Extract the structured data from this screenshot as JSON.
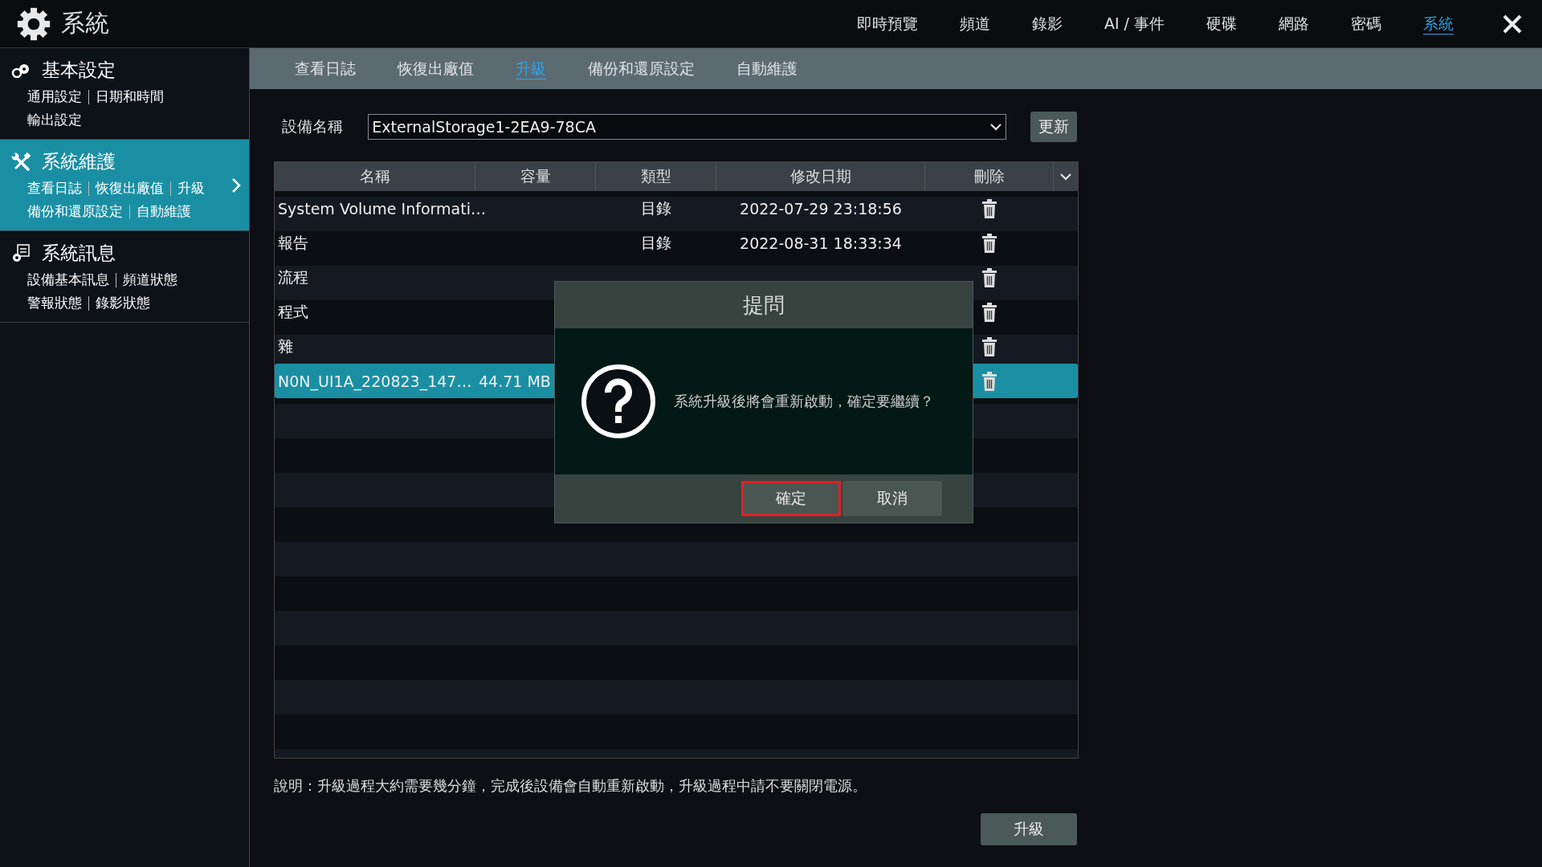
{
  "header": {
    "title": "系統",
    "nav": [
      {
        "label": "即時預覽",
        "selected": false
      },
      {
        "label": "頻道",
        "selected": false
      },
      {
        "label": "錄影",
        "selected": false
      },
      {
        "label": "AI / 事件",
        "selected": false
      },
      {
        "label": "硬碟",
        "selected": false
      },
      {
        "label": "網路",
        "selected": false
      },
      {
        "label": "密碼",
        "selected": false
      },
      {
        "label": "系統",
        "selected": true
      }
    ]
  },
  "sidebar": [
    {
      "kind": "gears",
      "title": "基本設定",
      "selected": false,
      "links": [
        [
          "通用設定",
          "日期和時間"
        ],
        [
          "輸出設定"
        ]
      ]
    },
    {
      "kind": "tools",
      "title": "系統維護",
      "selected": true,
      "links": [
        [
          "查看日誌",
          "恢復出廠值",
          "升級"
        ],
        [
          "備份和還原設定",
          "自動維護"
        ]
      ]
    },
    {
      "kind": "info",
      "title": "系統訊息",
      "selected": false,
      "links": [
        [
          "設備基本訊息",
          "頻道狀態"
        ],
        [
          "警報狀態",
          "錄影狀態"
        ]
      ]
    }
  ],
  "tabs": [
    {
      "label": "查看日誌",
      "selected": false
    },
    {
      "label": "恢復出廠值",
      "selected": false
    },
    {
      "label": "升級",
      "selected": true
    },
    {
      "label": "備份和還原設定",
      "selected": false
    },
    {
      "label": "自動維護",
      "selected": false
    }
  ],
  "device": {
    "label": "設備名稱",
    "value": "ExternalStorage1-2EA9-78CA",
    "refresh": "更新"
  },
  "table": {
    "columns": [
      "名稱",
      "容量",
      "類型",
      "修改日期",
      "刪除"
    ],
    "rows": [
      {
        "name": "System Volume Informati…",
        "type": "目錄",
        "date": "2022-07-29 23:18:56",
        "selected": false
      },
      {
        "name": "報告",
        "type": "目錄",
        "date": "2022-08-31 18:33:34",
        "selected": false
      },
      {
        "name": "流程",
        "selected": false
      },
      {
        "name": "程式",
        "selected": false
      },
      {
        "name": "雜",
        "selected": false
      },
      {
        "name": "N0N_UI1A_220823_147…",
        "size": "44.71 MB",
        "selected": true
      }
    ]
  },
  "note": "說明：升級過程大約需要幾分鐘，完成後設備會自動重新啟動，升級過程中請不要關閉電源。",
  "upgrade": "升級",
  "dialog": {
    "title": "提問",
    "message": "系統升級後將會重新啟動，確定要繼續？",
    "buttons": [
      {
        "label": "確定",
        "selected": true
      },
      {
        "label": "取消",
        "selected": false
      }
    ]
  }
}
